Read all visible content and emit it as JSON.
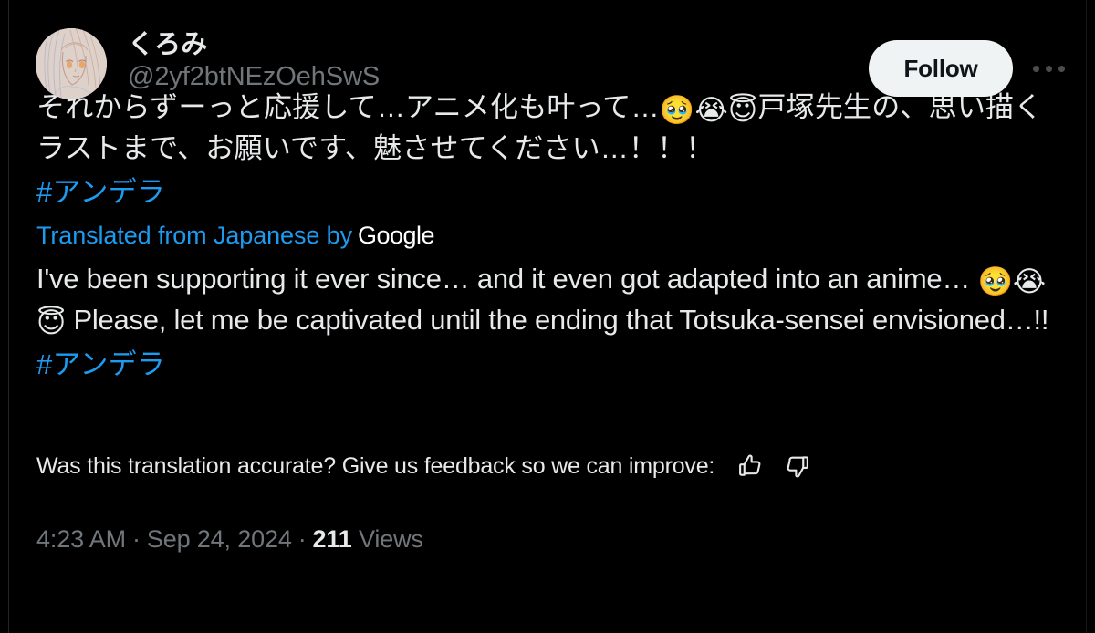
{
  "theme": {
    "background": "#000000",
    "text_primary": "#e7e9ea",
    "text_secondary": "#71767b",
    "link_blue": "#1d9bf0",
    "follow_bg": "#eff3f4",
    "follow_fg": "#0f1419"
  },
  "header": {
    "display_name": "くろみ",
    "handle": "@2yf2btNEzOehSwS",
    "avatar_alt": "avatar",
    "follow_label": "Follow",
    "more_label": "···"
  },
  "post": {
    "original_text_part1": "それからずーっと応援して…アニメ化も叶って…",
    "original_emoji": "🥹😭😇",
    "original_text_part2": "戸塚先生の、思い描くラストまで、お願いです、魅させてください…！！！",
    "original_hashtag": "#アンデラ",
    "translated_by_label": "Translated from Japanese by",
    "translated_by_brand": "Google",
    "translated_text_part1": "I've been supporting it ever since… and it even got adapted into an anime… ",
    "translated_emoji": "🥹😭😇",
    "translated_text_part2": " Please, let me be captivated until the ending that Totsuka-sensei envisioned…!!",
    "translated_hashtag": "#アンデラ"
  },
  "feedback": {
    "prompt": "Was this translation accurate? Give us feedback so we can improve:",
    "thumbs_up_label": "thumbs-up",
    "thumbs_down_label": "thumbs-down"
  },
  "meta": {
    "time": "4:23 AM",
    "separator1": "·",
    "date": "Sep 24, 2024",
    "separator2": "·",
    "view_count": "211",
    "views_label": "Views"
  }
}
